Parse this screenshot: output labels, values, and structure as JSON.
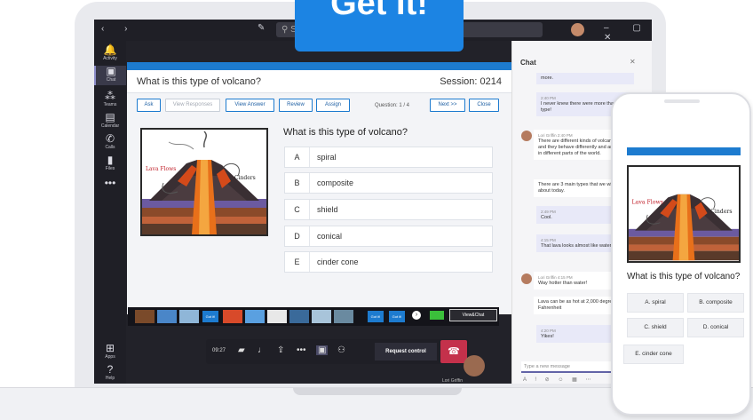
{
  "badge": {
    "label": "Get It!"
  },
  "titlebar": {
    "search": "S"
  },
  "rail": [
    {
      "label": "Activity",
      "icon": "bell-icon",
      "glyph": "🔔"
    },
    {
      "label": "Chat",
      "icon": "chat-icon",
      "glyph": "▣"
    },
    {
      "label": "Teams",
      "icon": "teams-icon",
      "glyph": "⁂"
    },
    {
      "label": "Calendar",
      "icon": "calendar-icon",
      "glyph": "▤"
    },
    {
      "label": "Calls",
      "icon": "phone-icon",
      "glyph": "✆"
    },
    {
      "label": "Files",
      "icon": "file-icon",
      "glyph": "▮"
    },
    {
      "label": "",
      "icon": "more-icon",
      "glyph": "•••"
    },
    {
      "label": "Apps",
      "icon": "apps-icon",
      "glyph": "⊞"
    },
    {
      "label": "Help",
      "icon": "help-icon",
      "glyph": "?"
    }
  ],
  "question_card": {
    "title": "What is this type of volcano?",
    "session": "Session: 0214",
    "toolbar": {
      "ask": "Ask",
      "view_responses": "View Responses",
      "view_answer": "View Answer",
      "review": "Review",
      "assign": "Assign",
      "question_count": "Question: 1 / 4",
      "next": "Next >>",
      "close": "Close"
    },
    "heading": "What is this type of volcano?",
    "diagram": {
      "lava_label": "Lava Flows",
      "cinders_label": "Cinders"
    },
    "answers": [
      {
        "letter": "A",
        "text": "spiral"
      },
      {
        "letter": "B",
        "text": "composite"
      },
      {
        "letter": "C",
        "text": "shield"
      },
      {
        "letter": "D",
        "text": "conical"
      },
      {
        "letter": "E",
        "text": "cinder cone"
      }
    ]
  },
  "thumbstrip": {
    "gotit": "Got it!",
    "view_chat": "View&Chat"
  },
  "callbar": {
    "timer": "09:27",
    "request_control": "Request control",
    "participant": "Lori Griffin"
  },
  "chat": {
    "title": "Chat",
    "messages": [
      {
        "meta": "",
        "text": "more."
      },
      {
        "meta": "2:40 PM",
        "text": "I never knew there were more than one type!"
      },
      {
        "meta": "Lori Griffin  2:40 PM",
        "text": "There are different kinds of volcanoes and they behave differently and are found in different parts of the world."
      },
      {
        "meta": "",
        "text": "There are 3 main types that we will learn about today."
      },
      {
        "meta": "2:49 PM",
        "text": "Cool."
      },
      {
        "meta": "4:15 PM",
        "text": "That lava looks almost like water!"
      },
      {
        "meta": "Lori Griffin  4:15 PM",
        "text": "Way hotter than water!"
      },
      {
        "meta": "",
        "text": "Lava can be as hot at 2,000 degrees Fahrenheit"
      },
      {
        "meta": "4:20 PM",
        "text": "Yikes!"
      }
    ],
    "input_placeholder": "Type a new message"
  },
  "phone": {
    "question": "What is this type of volcano?",
    "options": [
      "A. spiral",
      "B. composite",
      "C. shield",
      "D. conical",
      "E. cinder cone"
    ],
    "diagram": {
      "lava_label": "Lava Flows",
      "cinders_label": "Cinders"
    }
  }
}
